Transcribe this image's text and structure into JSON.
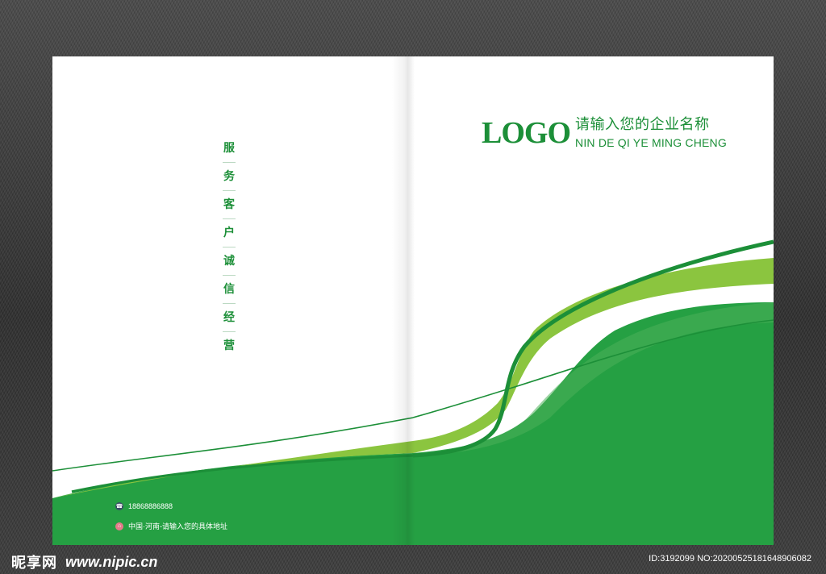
{
  "left_page": {
    "slogan_chars": [
      "服",
      "务",
      "客",
      "户",
      "诚",
      "信",
      "经",
      "营"
    ],
    "contact": {
      "phone_icon": "phone-icon",
      "phone": "18868886888",
      "address_icon": "home-icon",
      "address": "中国·河南-请输入您的具体地址"
    }
  },
  "right_page": {
    "logo_text": "LOGO",
    "company_name_cn": "请输入您的企业名称",
    "company_name_en": "NIN DE QI YE MING CHENG"
  },
  "watermark": {
    "site_cn": "昵享网",
    "site_url": "www.nipic.cn",
    "id_text": "ID:3192099 NO:20200525181648906082"
  },
  "colors": {
    "green_dark": "#1C8F38",
    "green_main": "#25A043",
    "green_light": "#8BC53F",
    "background": "#3A3A3A"
  }
}
